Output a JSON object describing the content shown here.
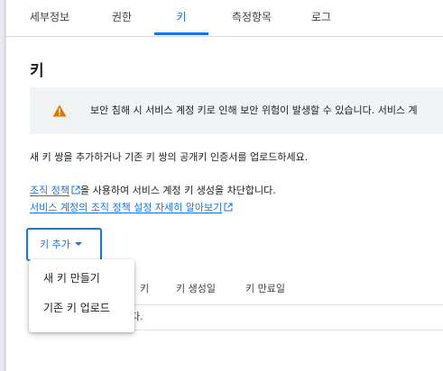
{
  "tabs": [
    {
      "label": "세부정보"
    },
    {
      "label": "권한"
    },
    {
      "label": "키",
      "active": true
    },
    {
      "label": "측정항목"
    },
    {
      "label": "로그"
    }
  ],
  "page_title": "키",
  "banner": {
    "icon": "warning-icon",
    "text": "보안 침해 시 서비스 계정 키로 인해 보안 위험이 발생할 수 있습니다. 서비스 계",
    "icon_color": "#e37400"
  },
  "description": "새 키 쌍을 추가하거나 기존 키 쌍의 공개키 인증서를 업로드하세요.",
  "policy": {
    "link_text": "조직 정책",
    "rest_text": "을 사용하여 서비스 계정 키 생성을 차단합니다.",
    "learn_more_link": "서비스 계정의 조직 정책 설정 자세히 알아보기"
  },
  "add_key_button": {
    "label": "키 추가"
  },
  "menu": {
    "items": [
      {
        "label": "새 키 만들기"
      },
      {
        "label": "기존 키 업로드"
      }
    ]
  },
  "table": {
    "columns": [
      "키",
      "키 생성일",
      "키 만료일"
    ],
    "empty_text_fragment": "다."
  },
  "colors": {
    "accent": "#1a73e8",
    "banner_bg": "#f1f3f4"
  }
}
